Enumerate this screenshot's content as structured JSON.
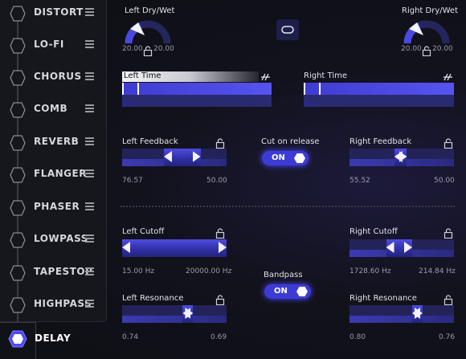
{
  "sidebar": {
    "items": [
      {
        "label": "DISTORT"
      },
      {
        "label": "LO-FI"
      },
      {
        "label": "CHORUS"
      },
      {
        "label": "COMB"
      },
      {
        "label": "REVERB"
      },
      {
        "label": "FLANGER"
      },
      {
        "label": "PHASER"
      },
      {
        "label": "LOWPASS"
      },
      {
        "label": "TAPESTOP"
      },
      {
        "label": "HIGHPASS"
      }
    ],
    "active": {
      "label": "DELAY"
    }
  },
  "delay": {
    "left_drywet": {
      "label": "Left Dry/Wet",
      "min": "20.00",
      "max": "20.00",
      "value_fraction": 0.35
    },
    "right_drywet": {
      "label": "Right Dry/Wet",
      "min": "20.00",
      "max": "20.00",
      "value_fraction": 0.35
    },
    "left_time": {
      "label": "Left Time",
      "value_fraction": 0.1
    },
    "right_time": {
      "label": "Right Time",
      "value_fraction": 0.1
    },
    "left_feedback": {
      "label": "Left Feedback",
      "min": "76.57",
      "max": "50.00",
      "range": [
        0.4,
        0.75
      ]
    },
    "right_feedback": {
      "label": "Right Feedback",
      "min": "55.52",
      "max": "50.00",
      "range": [
        0.43,
        0.55
      ]
    },
    "cut_on_release": {
      "label": "Cut on release",
      "state": "ON"
    },
    "left_cutoff": {
      "label": "Left Cutoff",
      "min": "15.00 Hz",
      "max": "20000.00 Hz",
      "range": [
        0.0,
        1.0
      ]
    },
    "right_cutoff": {
      "label": "Right Cutoff",
      "min": "1728.60 Hz",
      "max": "214.84 Hz",
      "range": [
        0.35,
        0.6
      ]
    },
    "bandpass": {
      "label": "Bandpass",
      "state": "ON"
    },
    "left_resonance": {
      "label": "Left Resonance",
      "min": "0.74",
      "max": "0.69",
      "range": [
        0.58,
        0.68
      ]
    },
    "right_resonance": {
      "label": "Right Resonance",
      "min": "0.80",
      "max": "0.76",
      "range": [
        0.6,
        0.7
      ]
    }
  },
  "colors": {
    "accent": "#4a48ff",
    "fill": "#3a38c8",
    "track": "#23235a",
    "sidebar": "#16161d"
  }
}
